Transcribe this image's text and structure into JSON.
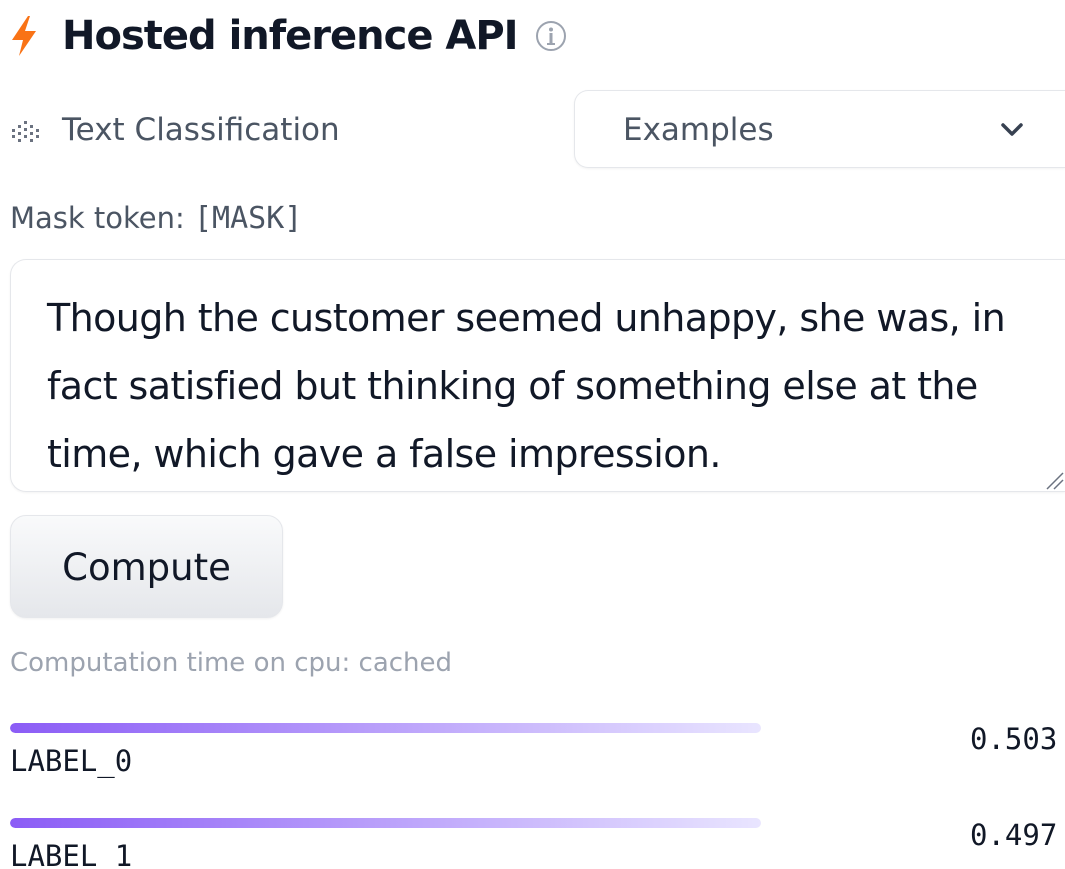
{
  "header": {
    "title": "Hosted inference API",
    "lightning_icon": "lightning-bolt-icon",
    "info_icon": "info-circle-icon",
    "accent_color": "#f97316"
  },
  "task": {
    "icon": "text-classification-icon",
    "label": "Text Classification"
  },
  "examples": {
    "label": "Examples",
    "icon": "chevron-down-icon"
  },
  "mask": {
    "label": "Mask token:",
    "token": "[MASK]"
  },
  "input": {
    "value": "Though the customer seemed unhappy, she was, in fact satisfied but thinking of something else at the time, which gave a false impression."
  },
  "compute": {
    "label": "Compute"
  },
  "status": {
    "computation_time": "Computation time on cpu: cached"
  },
  "results": [
    {
      "label": "LABEL_0",
      "score": "0.503",
      "fraction": 1.0
    },
    {
      "label": "LABEL_1",
      "score": "0.497",
      "fraction": 1.0
    }
  ],
  "colors": {
    "bar_start": "#8b5cf6",
    "bar_end": "#e9e5ff"
  }
}
